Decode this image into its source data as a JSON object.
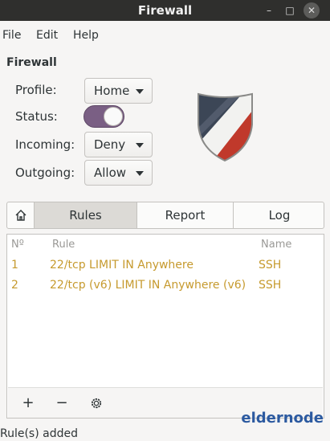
{
  "window": {
    "title": "Firewall",
    "controls": {
      "minimize": "–",
      "maximize": "□",
      "close": "✕"
    }
  },
  "menu": [
    "File",
    "Edit",
    "Help"
  ],
  "section_title": "Firewall",
  "form": {
    "profile": {
      "label": "Profile:",
      "value": "Home"
    },
    "status": {
      "label": "Status:",
      "on": true
    },
    "incoming": {
      "label": "Incoming:",
      "value": "Deny"
    },
    "outgoing": {
      "label": "Outgoing:",
      "value": "Allow"
    }
  },
  "tabs": {
    "rules": "Rules",
    "report": "Report",
    "log": "Log",
    "home_icon": "home-icon"
  },
  "rules": {
    "headers": {
      "num": "Nº",
      "rule": "Rule",
      "name": "Name"
    },
    "rows": [
      {
        "num": "1",
        "rule": "22/tcp LIMIT IN Anywhere",
        "name": "SSH"
      },
      {
        "num": "2",
        "rule": "22/tcp (v6) LIMIT IN Anywhere (v6)",
        "name": "SSH"
      }
    ],
    "toolbar": {
      "add": "+",
      "remove": "−",
      "settings_icon": "gear-icon"
    }
  },
  "status_message": "Rule(s) added",
  "watermark": "eldernode",
  "colors": {
    "rule_text": "#c69a2e",
    "toggle_on": "#7a5f84",
    "titlebar": "#2f2f2d"
  }
}
